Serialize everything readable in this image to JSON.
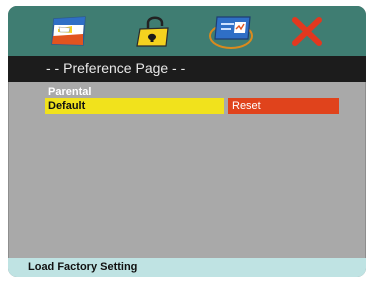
{
  "tabs": [
    {
      "icon": "picture-settings-icon"
    },
    {
      "icon": "lock-icon"
    },
    {
      "icon": "display-setup-icon"
    },
    {
      "icon": "exit-icon"
    }
  ],
  "header": {
    "title": "- -  Preference Page  - -"
  },
  "section": {
    "label": "Parental"
  },
  "items": {
    "default_label": "Default",
    "reset_label": "Reset"
  },
  "status": {
    "text": "Load Factory Setting"
  },
  "colors": {
    "tabbar": "#3f7d72",
    "titlebar": "#1c1c1c",
    "panel": "#a9a9a9",
    "highlight": "#f1e21c",
    "action": "#e0431c",
    "statusbar": "#bfe3e3"
  }
}
